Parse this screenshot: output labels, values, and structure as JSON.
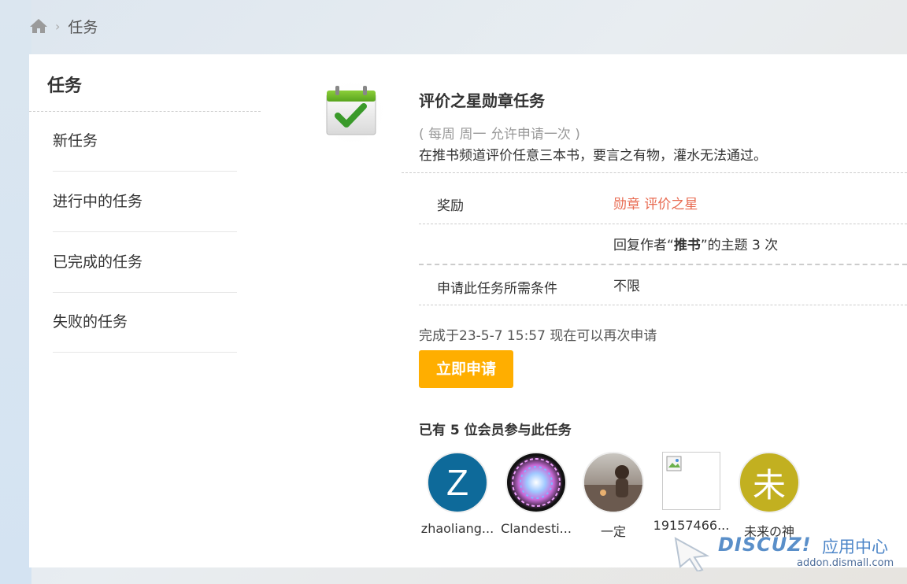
{
  "breadcrumb": {
    "home_icon": "home-icon",
    "separator": "›",
    "current": "任务"
  },
  "sidebar": {
    "title": "任务",
    "items": [
      {
        "label": "新任务"
      },
      {
        "label": "进行中的任务"
      },
      {
        "label": "已完成的任务"
      },
      {
        "label": "失败的任务"
      }
    ]
  },
  "task": {
    "icon": "calendar-check-icon",
    "name": "评价之星勋章任务",
    "period": "( 每周 周一 允许申请一次 )",
    "description": "在推书频道评价任意三本书，要言之有物，灌水无法通过。",
    "reward_label": "奖励",
    "reward_value": "勋章 评价之星",
    "requirement_prefix": "回复作者“",
    "requirement_author": "推书",
    "requirement_suffix": "”的主题 3 次",
    "condition_label": "申请此任务所需条件",
    "condition_value": "不限",
    "completed_info": "完成于23-5-7 15:57 现在可以再次申请",
    "apply_label": "立即申请",
    "reward_color": "#e8694f",
    "button_color": "#ffae00"
  },
  "participants": {
    "title": "已有 5 位会员参与此任务",
    "members": [
      {
        "name": "zhaoliang...",
        "avatar": "letter-z-avatar",
        "letter": "Z"
      },
      {
        "name": "Clandesti...",
        "avatar": "galaxy-avatar"
      },
      {
        "name": "一定",
        "avatar": "photo-avatar"
      },
      {
        "name": "19157466...",
        "avatar": "broken-image-icon"
      },
      {
        "name": "未来の神",
        "avatar": "letter-avatar",
        "letter": "未"
      }
    ]
  },
  "watermark": {
    "logo": "DISCUZ!",
    "title": "应用中心",
    "url": "addon.dismall.com"
  }
}
